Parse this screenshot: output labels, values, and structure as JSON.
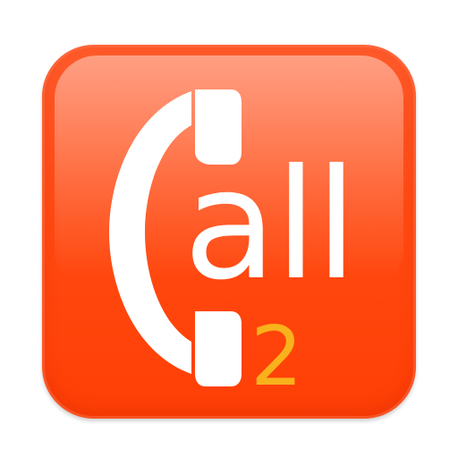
{
  "icon": {
    "name": "call2",
    "background_color": "#ff4a12",
    "glyph_color": "#ffffff",
    "accent_color": "#f7b21c",
    "wordmark": "all",
    "number": "2"
  }
}
